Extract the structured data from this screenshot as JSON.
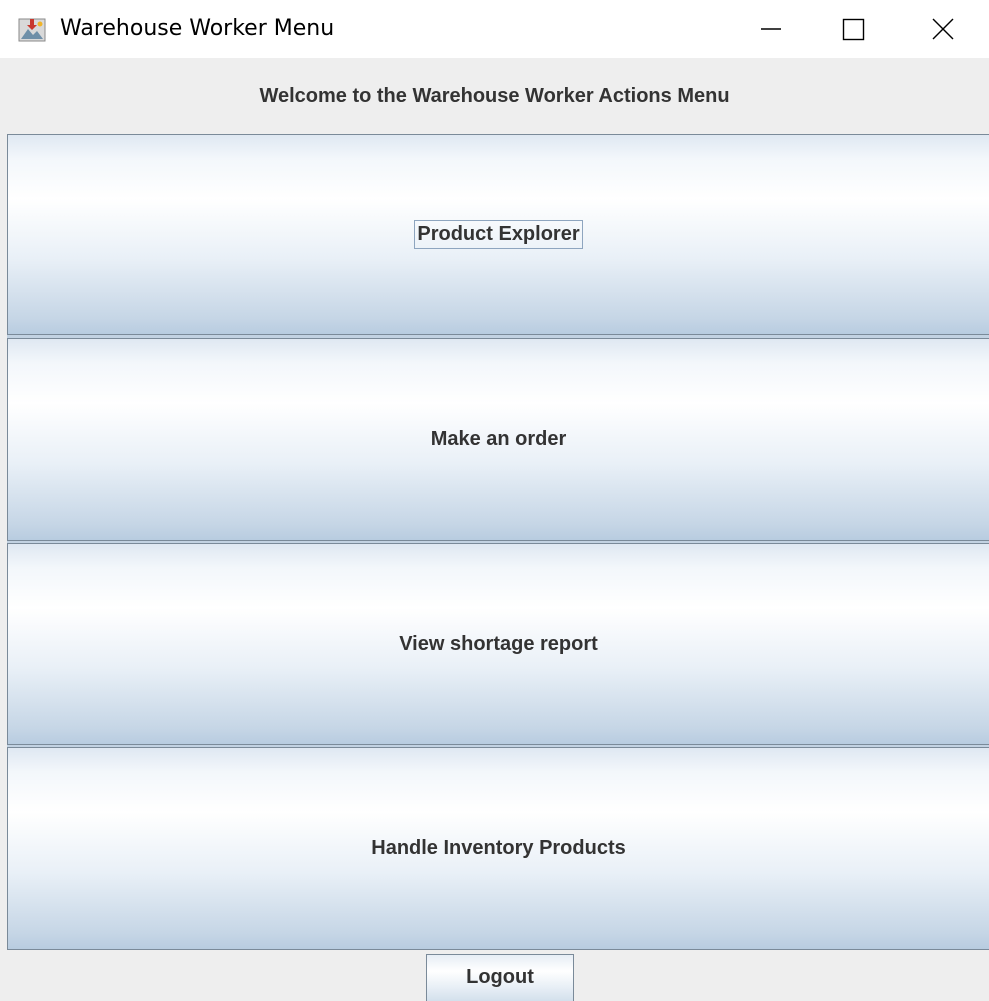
{
  "window": {
    "title": "Warehouse Worker Menu",
    "controls": {
      "minimize": "minimize",
      "maximize": "maximize",
      "close": "close"
    }
  },
  "header": {
    "welcome": "Welcome to the Warehouse Worker Actions Menu"
  },
  "actions": [
    {
      "label": "Product Explorer",
      "focused": true
    },
    {
      "label": "Make an order",
      "focused": false
    },
    {
      "label": "View shortage report",
      "focused": false
    },
    {
      "label": "Handle Inventory Products",
      "focused": false
    }
  ],
  "footer": {
    "logout_label": "Logout"
  },
  "colors": {
    "window_bg": "#eeeeee",
    "text": "#333333",
    "button_border": "#7a8a99",
    "button_gradient_light": "#ffffff",
    "button_gradient_dark": "#b8cce0"
  },
  "icons": {
    "app": "java-app-icon",
    "minimize": "minimize-icon",
    "maximize": "maximize-icon",
    "close": "close-icon"
  }
}
